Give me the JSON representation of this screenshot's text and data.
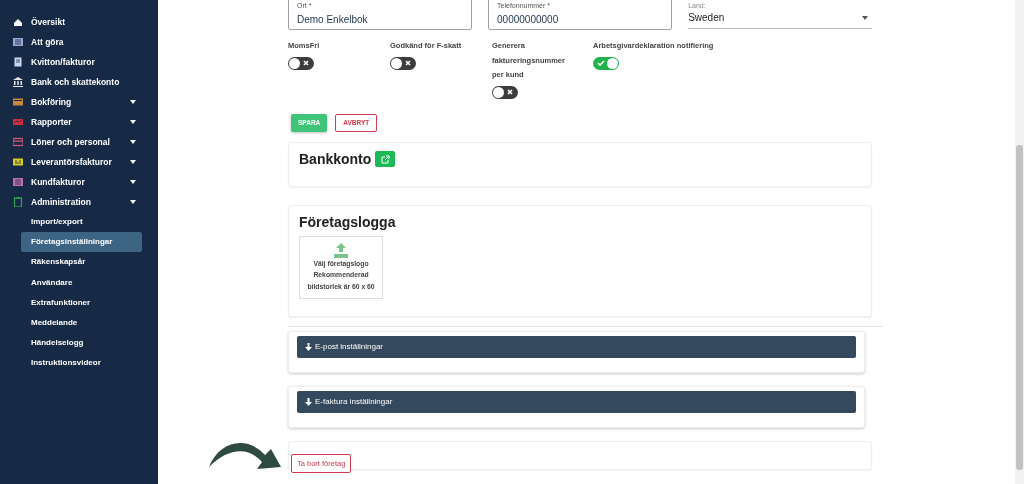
{
  "sidebar": {
    "items": [
      {
        "kind": "link",
        "label": "Översikt",
        "color": "#ffffff",
        "selected": false
      },
      {
        "kind": "link",
        "label": "Att göra",
        "color": "#9aa6d8",
        "selected": false
      },
      {
        "kind": "link",
        "label": "Kvitton/fakturor",
        "color": "#c9d8ef",
        "selected": false
      },
      {
        "kind": "link",
        "label": "Bank och skattekonto",
        "color": "#e6e6e6",
        "selected": false
      },
      {
        "kind": "group",
        "label": "Bokföring",
        "color": "#c8893a",
        "selected": false
      },
      {
        "kind": "group",
        "label": "Rapporter",
        "color": "#d62b3a",
        "selected": false
      },
      {
        "kind": "group",
        "label": "Löner och personal",
        "color": "#e0577a",
        "selected": false
      },
      {
        "kind": "group",
        "label": "Leverantörsfakturor",
        "color": "#d9c92a",
        "selected": false
      },
      {
        "kind": "group",
        "label": "Kundfakturor",
        "color": "#c46fb4",
        "selected": false
      },
      {
        "kind": "group",
        "label": "Administration",
        "color": "#2fa84f",
        "selected": false,
        "children": [
          {
            "label": "Import/export",
            "selected": false
          },
          {
            "label": "Företagsinställningar",
            "selected": true
          },
          {
            "label": "Räkenskapsår",
            "selected": false
          },
          {
            "label": "Användare",
            "selected": false
          },
          {
            "label": "Extrafunktioner",
            "selected": false
          },
          {
            "label": "Meddelande",
            "selected": false
          },
          {
            "label": "Händelselogg",
            "selected": false
          },
          {
            "label": "Instruktionsvideor",
            "selected": false
          }
        ]
      }
    ]
  },
  "fields": [
    {
      "kind": "text",
      "label": "Ort *",
      "value": "Demo Enkelbok"
    },
    {
      "kind": "text",
      "label": "Telefonnummer *",
      "value": "00000000000"
    },
    {
      "kind": "select",
      "label": "Land:",
      "value": "Sweden"
    }
  ],
  "toggles": [
    {
      "label": "MomsFri",
      "on": false
    },
    {
      "label": "Godkänd för F-skatt",
      "on": false
    },
    {
      "label": "Generera faktureringsnummer per kund",
      "on": false
    },
    {
      "label": "Arbetsgivardeklaration notifiering",
      "on": true
    }
  ],
  "buttons": {
    "save": "SPARA",
    "cancel": "AVBRYT"
  },
  "bank": {
    "title": "Bankkonto"
  },
  "logo": {
    "title": "Företagslogga",
    "upload_lines": [
      "Välj företagslogo",
      "Rekommenderad",
      "bildstorlek är 60 x 60"
    ]
  },
  "panels": [
    {
      "title": "E-post inställningar",
      "expanded": false
    },
    {
      "title": "E-faktura inställningar",
      "expanded": false
    }
  ],
  "delete": {
    "label": "Ta bort företag"
  }
}
